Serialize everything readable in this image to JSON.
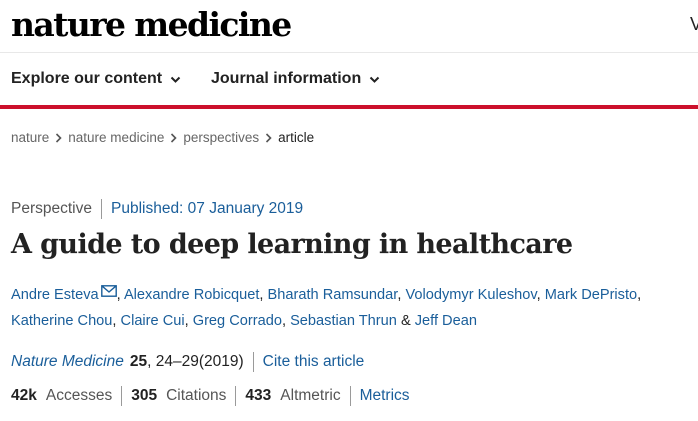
{
  "header": {
    "logo_text": "nature medicine",
    "edge_partial": "V"
  },
  "nav": {
    "items": [
      {
        "label": "Explore our content"
      },
      {
        "label": "Journal information"
      }
    ]
  },
  "breadcrumb": {
    "items": [
      "nature",
      "nature medicine",
      "perspectives"
    ],
    "current": "article"
  },
  "article": {
    "type": "Perspective",
    "published": "Published: 07 January 2019",
    "title": "A guide to deep learning in healthcare",
    "authors": [
      "Andre Esteva",
      "Alexandre Robicquet",
      "Bharath Ramsundar",
      "Volodymyr Kuleshov",
      "Mark DePristo",
      "Katherine Chou",
      "Claire Cui",
      "Greg Corrado",
      "Sebastian Thrun",
      "Jeff Dean"
    ],
    "author_sep": ", ",
    "author_and": " & ",
    "citation": {
      "journal": "Nature Medicine",
      "volume": "25",
      "pages": ", 24–29(2019)",
      "cite_link": "Cite this article"
    },
    "metrics": {
      "accesses_value": "42k",
      "accesses_label": "Accesses",
      "citations_value": "305",
      "citations_label": "Citations",
      "altmetric_value": "433",
      "altmetric_label": "Altmetric",
      "metrics_link": "Metrics"
    }
  },
  "colors": {
    "brand_red": "#cc0f2b",
    "link_blue": "#1a5e9a",
    "text": "#222222"
  },
  "icons": [
    "chevron-down-icon",
    "chevron-right-icon",
    "mail-icon"
  ]
}
